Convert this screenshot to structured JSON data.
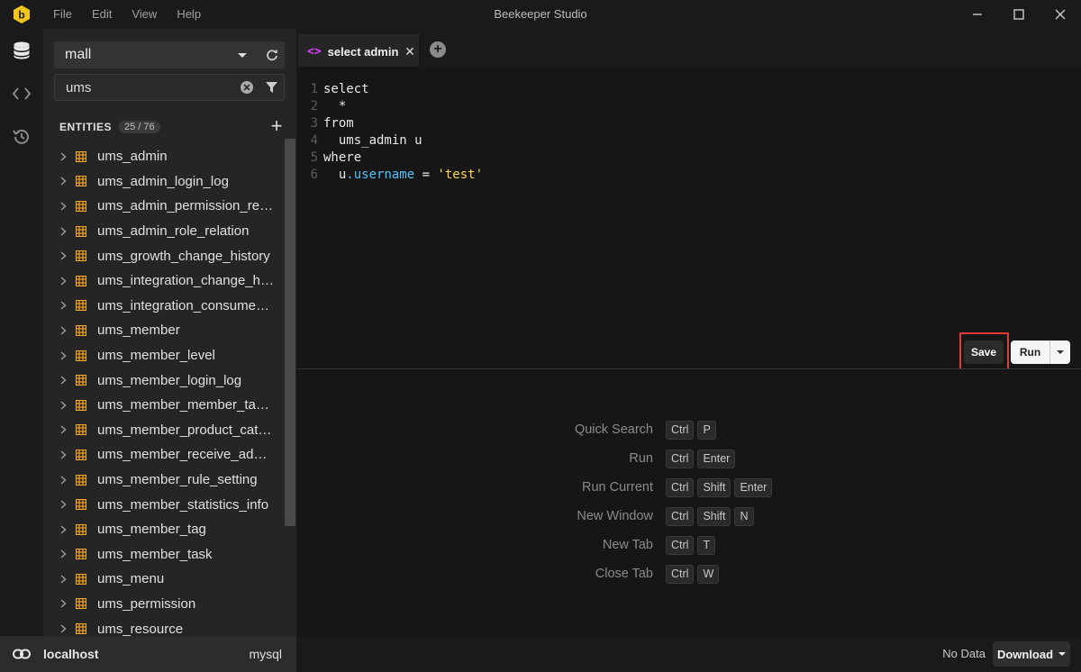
{
  "app": {
    "title": "Beekeeper Studio",
    "menu": [
      "File",
      "Edit",
      "View",
      "Help"
    ]
  },
  "rail": {
    "items": [
      "database-icon",
      "code-icon",
      "history-icon"
    ]
  },
  "sidebar": {
    "database": "mall",
    "search_value": "ums",
    "entities_title": "ENTITIES",
    "entities_count": "25 / 76",
    "entities": [
      "ums_admin",
      "ums_admin_login_log",
      "ums_admin_permission_relation",
      "ums_admin_role_relation",
      "ums_growth_change_history",
      "ums_integration_change_history",
      "ums_integration_consume_setting",
      "ums_member",
      "ums_member_level",
      "ums_member_login_log",
      "ums_member_member_tag_relation",
      "ums_member_product_category_relation",
      "ums_member_receive_address",
      "ums_member_rule_setting",
      "ums_member_statistics_info",
      "ums_member_tag",
      "ums_member_task",
      "ums_menu",
      "ums_permission",
      "ums_resource"
    ]
  },
  "tab": {
    "icon": "<>",
    "label": "select admin"
  },
  "editor": {
    "lines": [
      {
        "n": "1",
        "parts": [
          {
            "c": "kw",
            "t": "select"
          }
        ]
      },
      {
        "n": "2",
        "parts": [
          {
            "c": "plain",
            "t": "  *"
          }
        ]
      },
      {
        "n": "3",
        "parts": [
          {
            "c": "kw",
            "t": "from"
          }
        ]
      },
      {
        "n": "4",
        "parts": [
          {
            "c": "plain",
            "t": "  ums_admin u"
          }
        ]
      },
      {
        "n": "5",
        "parts": [
          {
            "c": "kw",
            "t": "where"
          }
        ]
      },
      {
        "n": "6",
        "parts": [
          {
            "c": "plain",
            "t": "  u"
          },
          {
            "c": "prop",
            "t": ".username"
          },
          {
            "c": "plain",
            "t": " = "
          },
          {
            "c": "str",
            "t": "'test'"
          }
        ]
      }
    ],
    "save_label": "Save",
    "run_label": "Run"
  },
  "shortcuts": [
    {
      "label": "Quick Search",
      "keys": [
        "Ctrl",
        "P"
      ]
    },
    {
      "label": "Run",
      "keys": [
        "Ctrl",
        "Enter"
      ]
    },
    {
      "label": "Run Current",
      "keys": [
        "Ctrl",
        "Shift",
        "Enter"
      ]
    },
    {
      "label": "New Window",
      "keys": [
        "Ctrl",
        "Shift",
        "N"
      ]
    },
    {
      "label": "New Tab",
      "keys": [
        "Ctrl",
        "T"
      ]
    },
    {
      "label": "Close Tab",
      "keys": [
        "Ctrl",
        "W"
      ]
    }
  ],
  "status": {
    "connection": "localhost",
    "db_type": "mysql",
    "result_info": "No Data",
    "download_label": "Download"
  },
  "colors": {
    "accent": "#e040fb",
    "logo_yellow": "#f5c518",
    "table_icon": "#f5a623",
    "highlight": "#e53935"
  }
}
